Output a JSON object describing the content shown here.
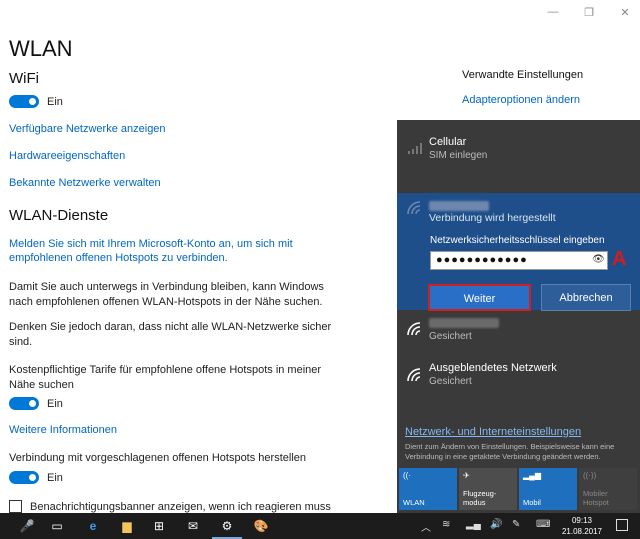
{
  "window": {
    "controls": [
      "—",
      "❐",
      "✕"
    ]
  },
  "settings": {
    "title": "WLAN",
    "wifi_heading": "WiFi",
    "wifi_toggle_label": "Ein",
    "links": [
      "Verfügbare Netzwerke anzeigen",
      "Hardwareeigenschaften",
      "Bekannte Netzwerke verwalten"
    ],
    "services_heading": "WLAN-Dienste",
    "signin_link_1": "Melden Sie sich mit Ihrem Microsoft-Konto an, um sich mit",
    "signin_link_2": "empfohlenen offenen Hotspots zu verbinden.",
    "para1_l1": "Damit Sie auch unterwegs in Verbindung bleiben, kann Windows",
    "para1_l2": "nach empfohlenen offenen WLAN-Hotspots in der Nähe suchen.",
    "para2_l1": "Denken Sie jedoch daran, dass nicht alle WLAN-Netzwerke sicher",
    "para2_l2": "sind.",
    "para3_l1": "Kostenpflichtige Tarife für empfohlene offene Hotspots in meiner",
    "para3_l2": "Nähe suchen",
    "toggle2_label": "Ein",
    "more_info": "Weitere Informationen",
    "para4": "Verbindung mit vorgeschlagenen offenen Hotspots herstellen",
    "toggle3_label": "Ein",
    "checkbox_label": "Benachrichtigungsbanner anzeigen, wenn ich reagieren muss"
  },
  "related": {
    "heading": "Verwandte Einstellungen",
    "link": "Adapteroptionen ändern"
  },
  "flyout": {
    "cellular_name": "Cellular",
    "cellular_sub": "SIM einlegen",
    "connecting_status": "Verbindung wird hergestellt",
    "key_label": "Netzwerksicherheitsschlüssel eingeben",
    "password_mask": "●●●●●●●●●●●●",
    "btn_next": "Weiter",
    "btn_cancel": "Abbrechen",
    "marker": "A",
    "net2_sub": "Gesichert",
    "hidden_name": "Ausgeblendetes Netzwerk",
    "hidden_sub": "Gesichert",
    "settings_link": "Netzwerk- und Interneteinstellungen",
    "note": "Dient zum Ändern von Einstellungen. Beispielsweise kann eine Verbindung in eine getaktete Verbindung geändert werden.",
    "tiles": [
      {
        "label": "WLAN",
        "icon": "wifi-icon",
        "state": "on"
      },
      {
        "label": "Flugzeug-\nmodus",
        "icon": "airplane-icon",
        "state": "off"
      },
      {
        "label": "Mobil",
        "icon": "cellular-icon",
        "state": "on"
      },
      {
        "label": "Mobiler\nHotspot",
        "icon": "hotspot-icon",
        "state": "dis"
      }
    ]
  },
  "taskbar": {
    "time": "09:13",
    "date": "21.08.2017",
    "colors": {
      "bg": "#1c1c1c",
      "accent": "#0078d7"
    }
  }
}
